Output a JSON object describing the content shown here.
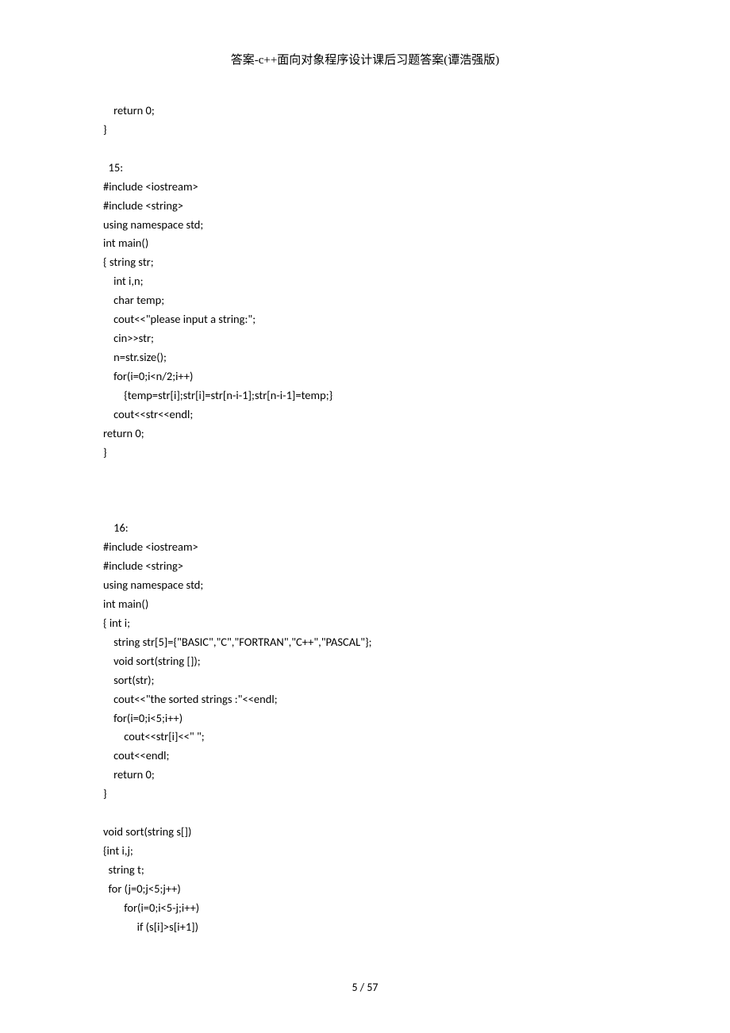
{
  "header": {
    "title": "答案-c++面向对象程序设计课后习题答案(谭浩强版)"
  },
  "code": {
    "block1": "    return 0;\n}\n\n  15:\n#include <iostream>\n#include <string>\nusing namespace std;\nint main()\n{ string str;\n    int i,n;\n    char temp;\n    cout<<\"please input a string:\";\n    cin>>str;\n    n=str.size();\n    for(i=0;i<n/2;i++)\n        {temp=str[i];str[i]=str[n-i-1];str[n-i-1]=temp;}\n    cout<<str<<endl;\nreturn 0;\n}\n\n\n\n    16:\n#include <iostream>\n#include <string>\nusing namespace std;\nint main()\n{ int i;\n    string str[5]={\"BASIC\",\"C\",\"FORTRAN\",\"C++\",\"PASCAL\"};\n    void sort(string []);\n    sort(str);\n    cout<<\"the sorted strings :\"<<endl;\n    for(i=0;i<5;i++)\n        cout<<str[i]<<\" \";\n    cout<<endl;\n    return 0;\n}\n\nvoid sort(string s[])\n{int i,j;\n  string t;\n  for (j=0;j<5;j++)\n        for(i=0;i<5-j;i++)\n             if (s[i]>s[i+1])"
  },
  "footer": {
    "page_number": "5 / 57"
  }
}
